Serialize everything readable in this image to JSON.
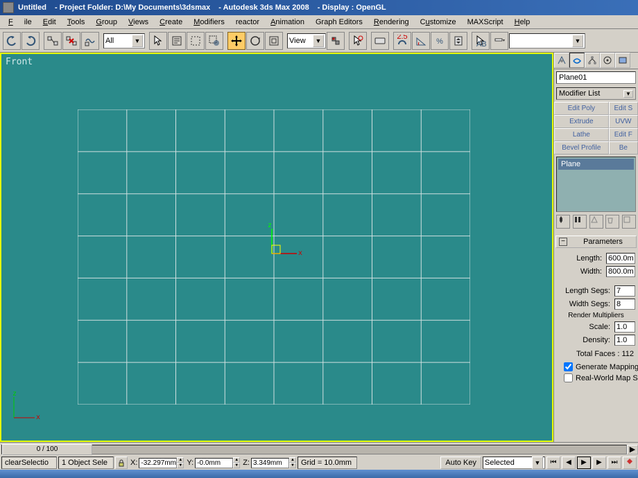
{
  "title": {
    "file": "Untitled",
    "folder": "- Project Folder: D:\\My Documents\\3dsmax",
    "app": "- Autodesk 3ds Max 2008",
    "display": "- Display : OpenGL"
  },
  "menu": {
    "file": "File",
    "edit": "Edit",
    "tools": "Tools",
    "group": "Group",
    "views": "Views",
    "create": "Create",
    "modifiers": "Modifiers",
    "reactor": "reactor",
    "animation": "Animation",
    "grapheditors": "Graph Editors",
    "rendering": "Rendering",
    "customize": "Customize",
    "maxscript": "MAXScript",
    "help": "Help"
  },
  "toolbar": {
    "filter": "All",
    "refcoord": "View",
    "snap_label": "2.5"
  },
  "viewport": {
    "label": "Front",
    "grid_cols": 8,
    "grid_rows": 7
  },
  "cmdpanel": {
    "object_name": "Plane01",
    "modifier_list_label": "Modifier List",
    "buttons": {
      "editpoly": "Edit Poly",
      "editspline": "Edit S",
      "extrude": "Extrude",
      "uvw": "UVW",
      "lathe": "Lathe",
      "editf": "Edit F",
      "bevel": "Bevel Profile",
      "bend": "Be"
    },
    "stack_item": "Plane",
    "rollup_title": "Parameters",
    "params": {
      "length_label": "Length:",
      "length": "600.0m",
      "width_label": "Width:",
      "width": "800.0m",
      "lsegs_label": "Length Segs:",
      "lsegs": "7",
      "wsegs_label": "Width Segs:",
      "wsegs": "8",
      "render_mult": "Render Multipliers",
      "scale_label": "Scale:",
      "scale": "1.0",
      "density_label": "Density:",
      "density": "1.0",
      "faces_label": "Total Faces : 112",
      "gen_mapping": "Generate Mapping",
      "realworld": "Real-World Map Siz"
    }
  },
  "timeline": {
    "frame": "0 / 100"
  },
  "status": {
    "cmd": "clearSelectio",
    "sel": "1 Object Sele",
    "x": "-32.297mm",
    "y": "-0.0mm",
    "z": "3.349mm",
    "grid": "Grid = 10.0mm",
    "autokey": "Auto Key",
    "keyfilter": "Selected"
  }
}
